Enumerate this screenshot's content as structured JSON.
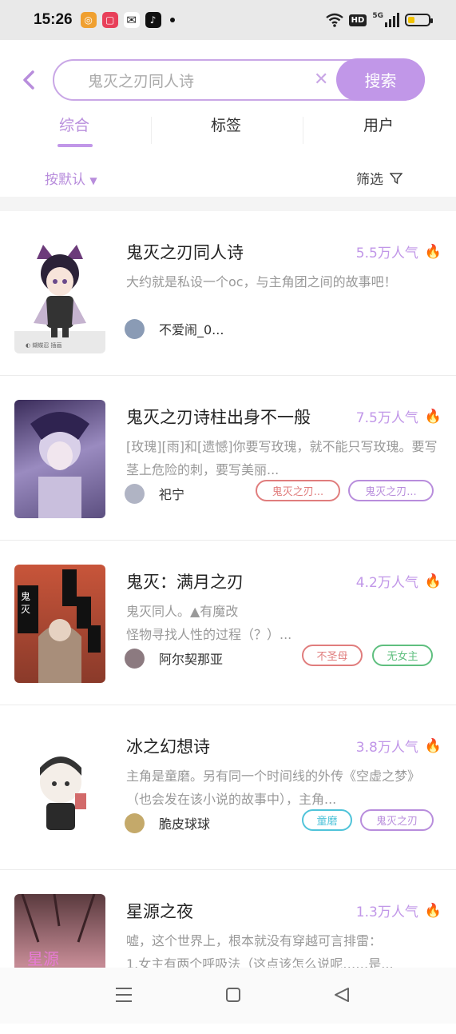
{
  "status": {
    "time": "15:26",
    "network": "5G"
  },
  "search": {
    "value": "鬼灭之刃同人诗",
    "button": "搜索"
  },
  "tabs": [
    "综合",
    "标签",
    "用户"
  ],
  "filter": {
    "sort": "按默认",
    "filter_label": "筛选"
  },
  "results": [
    {
      "title": "鬼灭之刃同人诗",
      "popularity": "5.5万人气",
      "desc": "大约就是私设一个oc，与主角团之间的故事吧！",
      "user": "不爱闹_0...",
      "tags": []
    },
    {
      "title": "鬼灭之刃诗柱出身不一般",
      "popularity": "7.5万人气",
      "desc": "[玫瑰][雨]和[遗憾]你要写玫瑰，就不能只写玫瑰。要写茎上危险的刺，要写美丽...",
      "user": "祀宁",
      "tags": [
        "鬼灭之刃...",
        "鬼灭之刃..."
      ]
    },
    {
      "title": "鬼灭：满月之刃",
      "popularity": "4.2万人气",
      "desc": "鬼灭同人。▲有魔改\n怪物寻找人性的过程（？）...",
      "user": "阿尔契那亚",
      "tags": [
        "不圣母",
        "无女主"
      ]
    },
    {
      "title": "冰之幻想诗",
      "popularity": "3.8万人气",
      "desc": "主角是童磨。另有同一个时间线的外传《空虚之梦》（也会发在该小说的故事中），主角...",
      "user": "脆皮球球",
      "tags": [
        "童磨",
        "鬼灭之刃"
      ]
    },
    {
      "title": "星源之夜",
      "popularity": "1.3万人气",
      "desc": "嘘，这个世界上，根本就没有穿越可言排雷：\n1.女主有两个呼吸法（这点该怎么说呢……是...",
      "user": "",
      "tags": []
    }
  ],
  "colors": {
    "accent": "#c197e8",
    "tag_red": "#e07d7d",
    "tag_green": "#5fbf7f",
    "tag_blue": "#4fc3d9",
    "tag_purple": "#b88ddc"
  }
}
